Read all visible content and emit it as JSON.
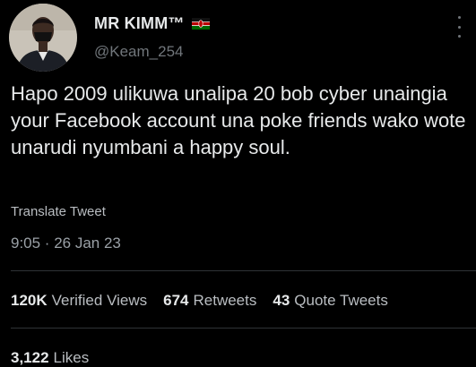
{
  "author": {
    "display_name": "MR KIMM™",
    "handle": "@Keam_254",
    "flag_icon": "kenya-flag-icon"
  },
  "tweet": {
    "text": "Hapo 2009 ulikuwa unalipa 20 bob cyber unaingia your Facebook account una poke friends wako wote unarudi nyumbani a happy soul.",
    "translate_label": "Translate Tweet",
    "timestamp": "9:05 · 26 Jan 23"
  },
  "stats": {
    "views_count": "120K",
    "views_label": "Verified Views",
    "retweets_count": "674",
    "retweets_label": "Retweets",
    "quotes_count": "43",
    "quotes_label": "Quote Tweets",
    "likes_count": "3,122",
    "likes_label": "Likes"
  },
  "colors": {
    "background": "#000000",
    "primary_text": "#e7e9ea",
    "secondary_text": "#71767b",
    "divider": "#2f3336"
  }
}
